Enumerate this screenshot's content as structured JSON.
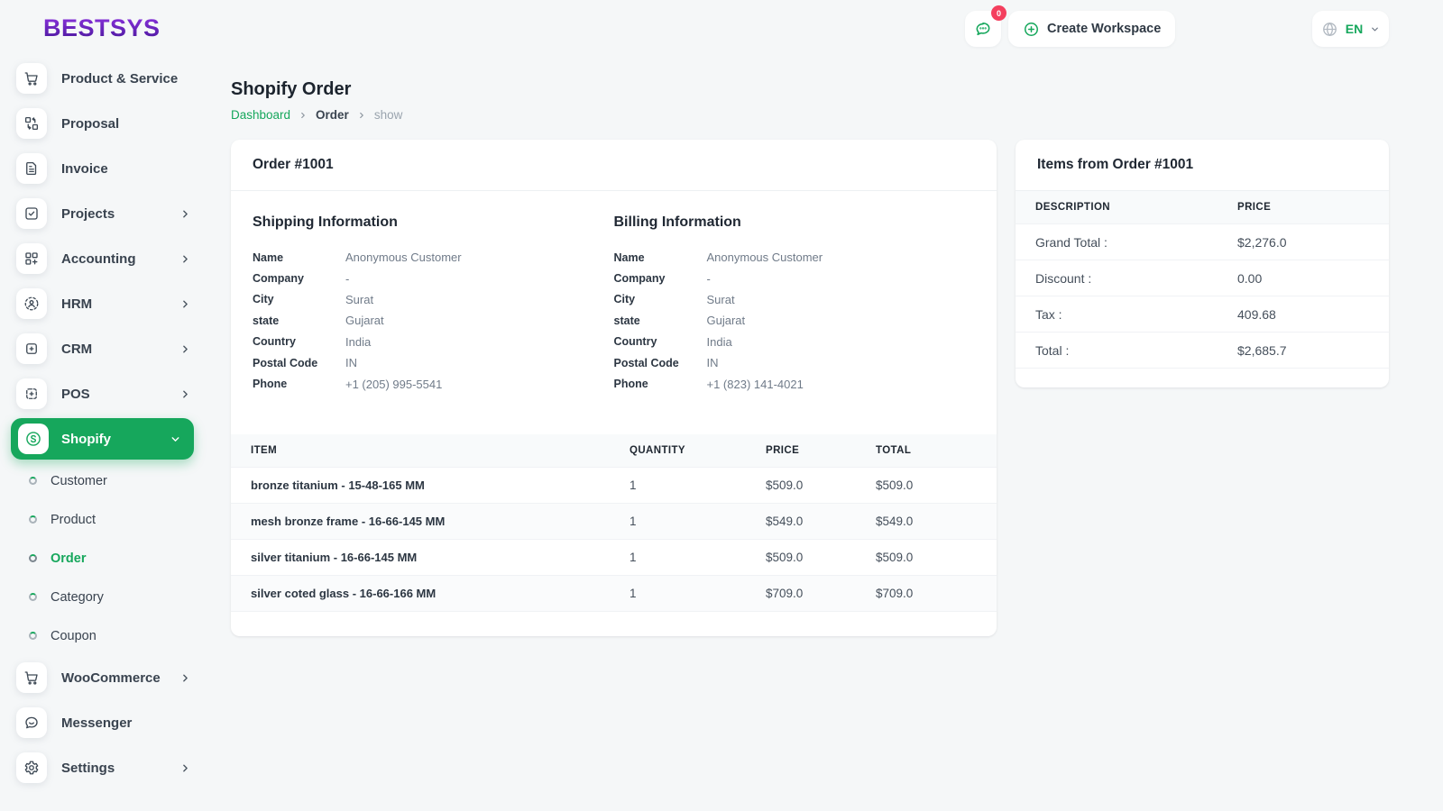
{
  "brand": {
    "name": "BESTSYS"
  },
  "colors": {
    "accent_green": "#16a75c",
    "badge_pink": "#f43f5e",
    "logo_purple_top": "#8f35e0",
    "logo_purple_bottom": "#471694",
    "page_background": "#f5f7f8"
  },
  "topbar": {
    "chat_badge": "0",
    "create_workspace_label": "Create Workspace",
    "language": "EN"
  },
  "sidebar": {
    "items": [
      {
        "label": "Product & Service",
        "icon": "cart-icon"
      },
      {
        "label": "Proposal",
        "icon": "proposal-icon"
      },
      {
        "label": "Invoice",
        "icon": "invoice-icon"
      },
      {
        "label": "Projects",
        "icon": "projects-check-icon"
      },
      {
        "label": "Accounting",
        "icon": "accounting-grid-icon"
      },
      {
        "label": "HRM",
        "icon": "hrm-user-icon"
      },
      {
        "label": "CRM",
        "icon": "crm-frame-icon"
      },
      {
        "label": "POS",
        "icon": "pos-frame-icon"
      },
      {
        "label": "Shopify",
        "icon": "shopify-icon"
      }
    ],
    "submenu": [
      "Customer",
      "Product",
      "Order",
      "Category",
      "Coupon"
    ],
    "items_bottom": [
      {
        "label": "WooCommerce",
        "icon": "cart-icon"
      },
      {
        "label": "Messenger",
        "icon": "messenger-icon"
      },
      {
        "label": "Settings",
        "icon": "gear-icon"
      }
    ]
  },
  "page": {
    "title": "Shopify Order",
    "breadcrumb": {
      "root": "Dashboard",
      "mid": "Order",
      "current": "show"
    }
  },
  "order_card": {
    "title": "Order #1001",
    "shipping": {
      "heading": "Shipping Information",
      "rows": [
        [
          "Name",
          "Anonymous Customer"
        ],
        [
          "Company",
          "-"
        ],
        [
          "City",
          "Surat"
        ],
        [
          "state",
          "Gujarat"
        ],
        [
          "Country",
          "India"
        ],
        [
          "Postal Code",
          "IN"
        ],
        [
          "Phone",
          "+1 (205) 995-5541"
        ]
      ]
    },
    "billing": {
      "heading": "Billing Information",
      "rows": [
        [
          "Name",
          "Anonymous Customer"
        ],
        [
          "Company",
          "-"
        ],
        [
          "City",
          "Surat"
        ],
        [
          "state",
          "Gujarat"
        ],
        [
          "Country",
          "India"
        ],
        [
          "Postal Code",
          "IN"
        ],
        [
          "Phone",
          "+1 (823) 141-4021"
        ]
      ]
    },
    "items_table": {
      "headers": [
        "ITEM",
        "QUANTITY",
        "PRICE",
        "TOTAL"
      ],
      "rows": [
        [
          "bronze titanium - 15-48-165 MM",
          "1",
          "$509.0",
          "$509.0"
        ],
        [
          "mesh bronze frame - 16-66-145 MM",
          "1",
          "$549.0",
          "$549.0"
        ],
        [
          "silver titanium - 16-66-145 MM",
          "1",
          "$509.0",
          "$509.0"
        ],
        [
          "silver coted glass - 16-66-166 MM",
          "1",
          "$709.0",
          "$709.0"
        ]
      ]
    }
  },
  "summary_card": {
    "title": "Items from Order #1001",
    "headers": [
      "DESCRIPTION",
      "PRICE"
    ],
    "rows": [
      [
        "Grand Total :",
        "$2,276.0"
      ],
      [
        "Discount :",
        "0.00"
      ],
      [
        "Tax :",
        "409.68"
      ],
      [
        "Total :",
        "$2,685.7"
      ]
    ]
  }
}
